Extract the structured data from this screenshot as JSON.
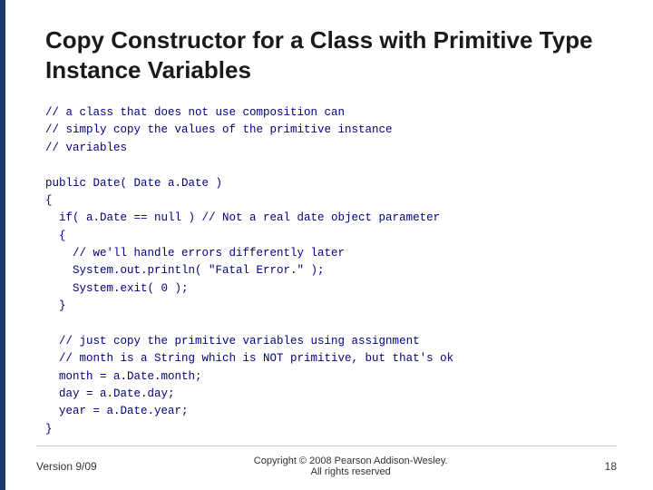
{
  "slide": {
    "title_line1": "Copy Constructor for a Class with Primitive Type",
    "title_line2": "Instance Variables",
    "code": "// a class that does not use composition can\n// simply copy the values of the primitive instance\n// variables\n\npublic Date( Date a.Date )\n{\n  if( a.Date == null ) // Not a real date object parameter\n  {\n    // we'll handle errors differently later\n    System.out.println( \"Fatal Error.\" );\n    System.exit( 0 );\n  }\n\n  // just copy the primitive variables using assignment\n  // month is a String which is NOT primitive, but that's ok\n  month = a.Date.month;\n  day = a.Date.day;\n  year = a.Date.year;\n}",
    "footer": {
      "version": "Version 9/09",
      "copyright_line1": "Copyright © 2008 Pearson Addison-Wesley.",
      "copyright_line2": "All rights reserved",
      "page": "18"
    }
  }
}
